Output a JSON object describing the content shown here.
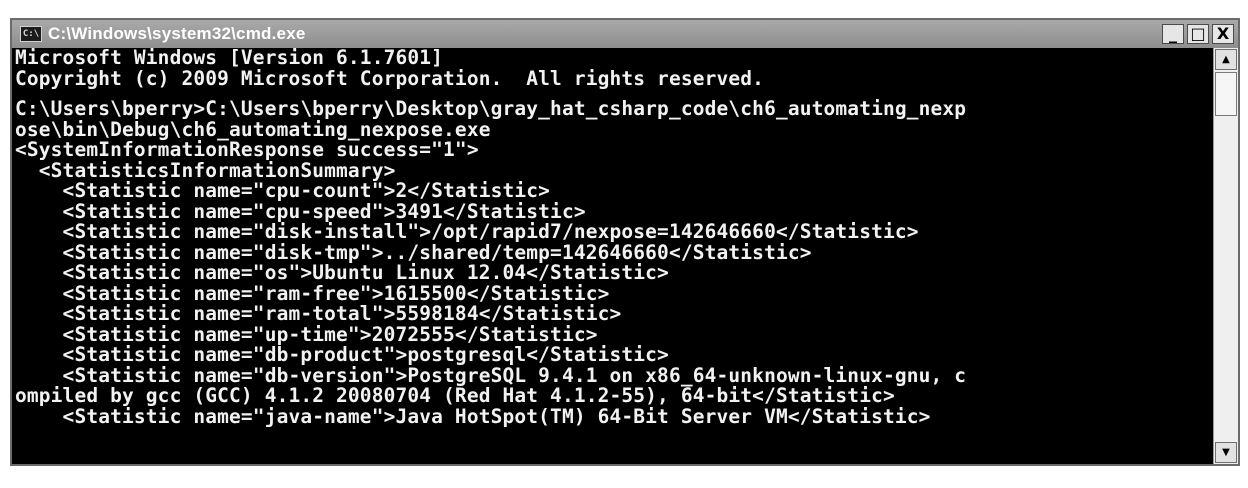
{
  "window": {
    "title": "C:\\Windows\\system32\\cmd.exe",
    "icon": "cmd-icon",
    "icon_text": "C:\\",
    "controls": {
      "minimize": "_",
      "maximize": "□",
      "close": "X"
    }
  },
  "console": {
    "header": [
      "Microsoft Windows [Version 6.1.7601]",
      "Copyright (c) 2009 Microsoft Corporation.  All rights reserved."
    ],
    "lines": [
      "C:\\Users\\bperry>C:\\Users\\bperry\\Desktop\\gray_hat_csharp_code\\ch6_automating_nexp",
      "ose\\bin\\Debug\\ch6_automating_nexpose.exe",
      "<SystemInformationResponse success=\"1\">",
      "  <StatisticsInformationSummary>",
      "    <Statistic name=\"cpu-count\">2</Statistic>",
      "    <Statistic name=\"cpu-speed\">3491</Statistic>",
      "    <Statistic name=\"disk-install\">/opt/rapid7/nexpose=142646660</Statistic>",
      "    <Statistic name=\"disk-tmp\">../shared/temp=142646660</Statistic>",
      "    <Statistic name=\"os\">Ubuntu Linux 12.04</Statistic>",
      "    <Statistic name=\"ram-free\">1615500</Statistic>",
      "    <Statistic name=\"ram-total\">5598184</Statistic>",
      "    <Statistic name=\"up-time\">2072555</Statistic>",
      "    <Statistic name=\"db-product\">postgresql</Statistic>",
      "    <Statistic name=\"db-version\">PostgreSQL 9.4.1 on x86_64-unknown-linux-gnu, c",
      "ompiled by gcc (GCC) 4.1.2 20080704 (Red Hat 4.1.2-55), 64-bit</Statistic>",
      "    <Statistic name=\"java-name\">Java HotSpot(TM) 64-Bit Server VM</Statistic>"
    ]
  },
  "scrollbar": {
    "up_arrow": "▲",
    "down_arrow": "▼"
  }
}
